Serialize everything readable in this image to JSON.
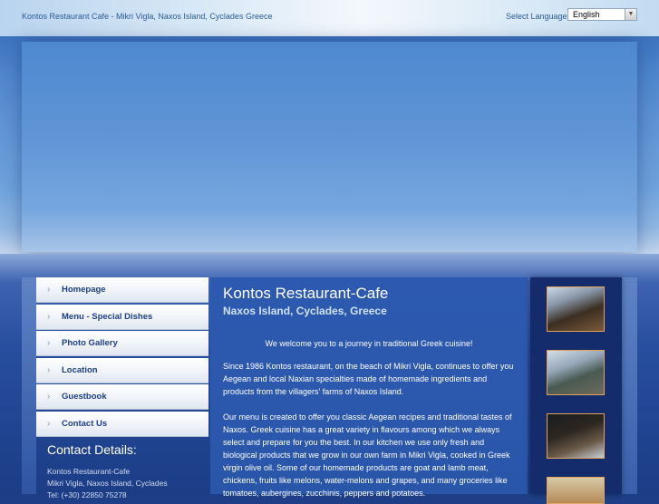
{
  "header": {
    "site_title": "Kontos Restaurant Cafe - Mikri Vigla, Naxos Island, Cyclades Greece",
    "language_label": "Select Language:",
    "language_selected": "English"
  },
  "nav": {
    "items": [
      {
        "label": "Homepage"
      },
      {
        "label": "Menu - Special Dishes"
      },
      {
        "label": "Photo Gallery"
      },
      {
        "label": "Location"
      },
      {
        "label": "Guestbook"
      },
      {
        "label": "Contact Us"
      }
    ]
  },
  "contact": {
    "heading": "Contact Details:",
    "name": "Kontos Restaurant-Cafe",
    "address": "Mikri Vigla, Naxos Island, Cyclades",
    "phone": "Tel: (+30) 22850 75278"
  },
  "main": {
    "title": "Kontos Restaurant-Cafe",
    "subtitle": "Naxos Island, Cyclades, Greece",
    "welcome": "We welcome you to a journey in traditional Greek cuisine!",
    "paragraph1": "Since 1986 Kontos restaurant, on the beach of Mikri Vigla, continues to offer you Aegean and local Naxian specialties made of homemade ingredients and products from the villagers' farms of Naxos Island.",
    "paragraph2": "Our menu is created to offer you classic Aegean recipes and traditional tastes of Naxos. Greek cuisine has a great variety in flavours among which we always select and prepare for you the best. In our kitchen we use only fresh and biological products that we grow in our own farm in Mikri Vigla, cooked in Greek virgin olive oil. Some of our homemade products are goat and lamb meat, chickens, fruits like melons, water-melons and grapes, and many groceries like tomatoes, aubergines, zucchinis, peppers and potatoes."
  },
  "colors": {
    "background": "#1e3f87",
    "nav_text": "#1c3f8a",
    "photo_border": "#e3a25a"
  }
}
